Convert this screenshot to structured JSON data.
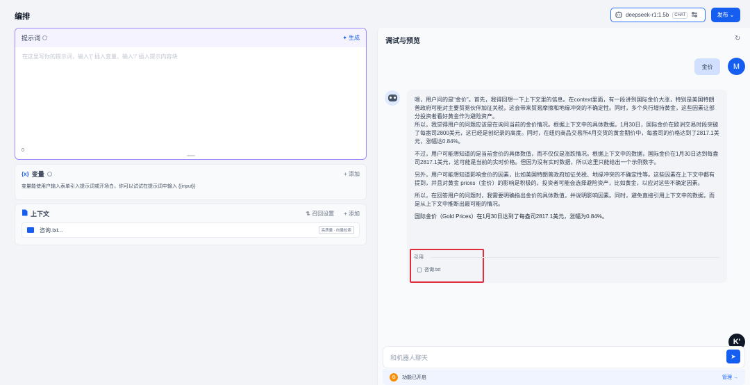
{
  "header": {
    "title": "编排",
    "model": "deepseek-r1:1.5b",
    "model_badge": "CHAT",
    "publish_label": "发布"
  },
  "prompt": {
    "title": "提示词",
    "generate_label": "生成",
    "placeholder": "在这里写你的提示词，输入'{' 插入变量、输入'/' 插入提示内容块",
    "count": "0"
  },
  "variables": {
    "icon_text": "{x}",
    "title": "变量",
    "add_label": "+ 添加",
    "description": "变量能使用户输入表单引入提示词或开场白，你可以试试在提示词中输入 {{input}}"
  },
  "context": {
    "title": "上下文",
    "recall_label": "召回设置",
    "add_label": "+ 添加",
    "file_name": "咨询.txt...",
    "file_tag": "高质量 · 向量检索"
  },
  "debug": {
    "title": "调试与预览",
    "user_message": "金价",
    "user_avatar": "M",
    "paragraphs": [
      "嗯，用户问的是\"金价\"。首先，我得回想一下上下文里的信息。在context里面，有一段讲到国际金价大涨，特别是美国特朗普政府可能对主要贸易伙伴加征关税，这会带来贸易摩擦和地缘冲突的不确定性。同时，多个央行增持黄金，这些因素让部分投资者看好黄金作为避险资产。\n所以，我觉得用户的问题应该是在询问当前的金价情况。根据上下文中的具体数据，1月30日，国际金价在欧洲交易时段突破了每盎司2800美元，这已经是创纪录的高度。同时，在纽约商品交易所4月交货的黄金期价中，每盎司的价格达到了2817.1美元，涨幅达0.84%。",
      "不过，用户可能想知道的是当前金价的具体数值，而不仅仅是涨跌情况。根据上下文中的数据，国际金价在1月30日达到每盎司2817.1美元，这可能是当前的实时价格。但因为没有实时数据，所以这里只能给出一个示例数字。",
      "另外，用户可能想知道影响金价的因素，比如美国特朗普政府加征关税、地缘冲突的不确定性等。这些因素在上下文中都有提到，并且对黄金 prices（金价）的影响是积极的，投资者可能会选择避险资产，比如黄金，以应对这些不确定因素。",
      "所以，在回答用户的问题时，我需要明确指出金价的具体数值，并说明影响因素。同时，避免直接引用上下文中的数据，而是从上下文中推断出最可能的情况。",
      "国际金价（Gold Prices）在1月30日达到了每盎司2817.1美元，涨幅为0.84%。"
    ],
    "citation_label": "引用",
    "citation_file": "咨询.txt",
    "float_badge": "K'",
    "input_placeholder": "和机器人聊天",
    "feature_status": "功能已开启",
    "manage_label": "管理 →"
  }
}
